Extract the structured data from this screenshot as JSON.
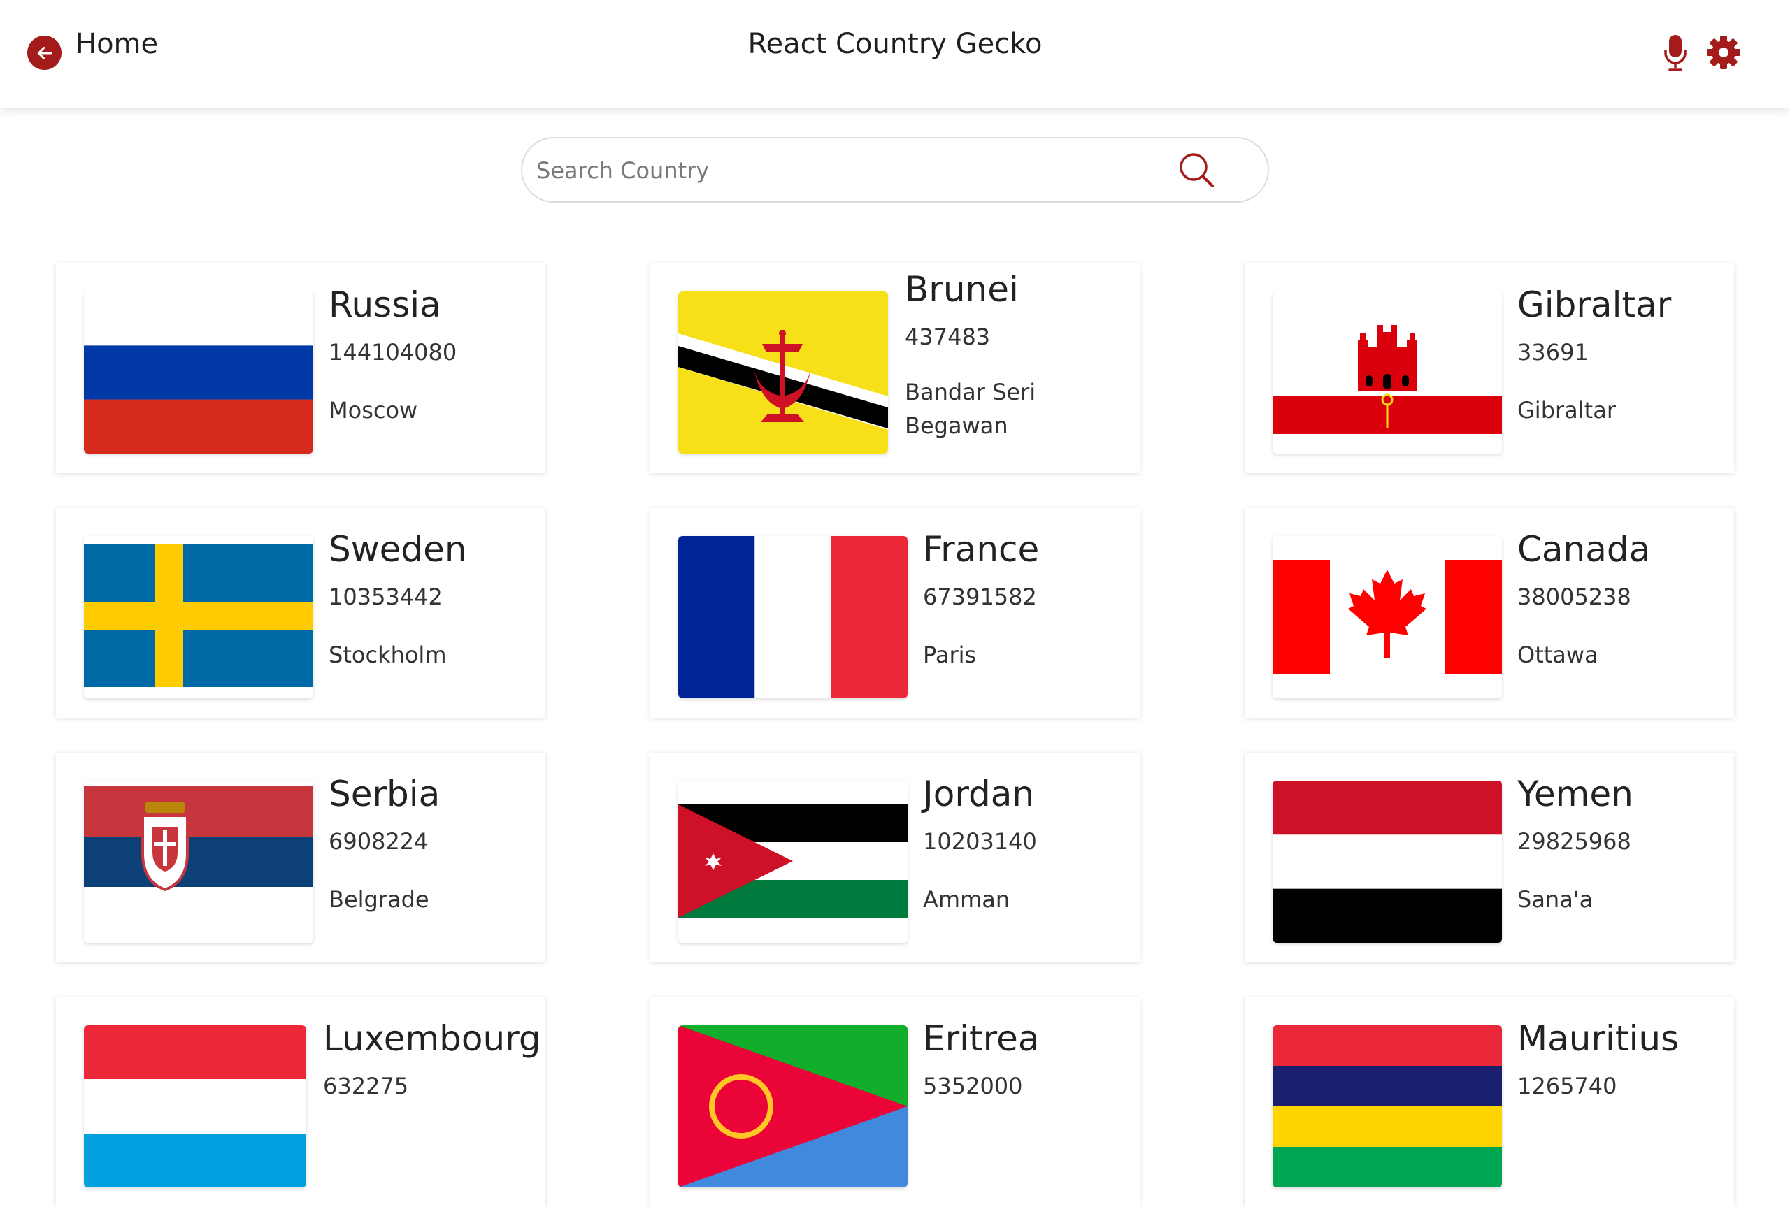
{
  "header": {
    "home_label": "Home",
    "app_title": "React Country Gecko",
    "accent_color": "#a31b1b",
    "icons": [
      "arrow-left-icon",
      "microphone-icon",
      "gear-icon"
    ]
  },
  "search": {
    "placeholder": "Search Country",
    "value": ""
  },
  "countries": [
    {
      "name": "Russia",
      "population": "144104080",
      "capital": "Moscow"
    },
    {
      "name": "Brunei",
      "population": "437483",
      "capital": "Bandar Seri Begawan"
    },
    {
      "name": "Gibraltar",
      "population": "33691",
      "capital": "Gibraltar"
    },
    {
      "name": "Sweden",
      "population": "10353442",
      "capital": "Stockholm"
    },
    {
      "name": "France",
      "population": "67391582",
      "capital": "Paris"
    },
    {
      "name": "Canada",
      "population": "38005238",
      "capital": "Ottawa"
    },
    {
      "name": "Serbia",
      "population": "6908224",
      "capital": "Belgrade"
    },
    {
      "name": "Jordan",
      "population": "10203140",
      "capital": "Amman"
    },
    {
      "name": "Yemen",
      "population": "29825968",
      "capital": "Sana'a"
    },
    {
      "name": "Luxembourg",
      "population": "632275",
      "capital": ""
    },
    {
      "name": "Eritrea",
      "population": "5352000",
      "capital": ""
    },
    {
      "name": "Mauritius",
      "population": "1265740",
      "capital": ""
    }
  ]
}
